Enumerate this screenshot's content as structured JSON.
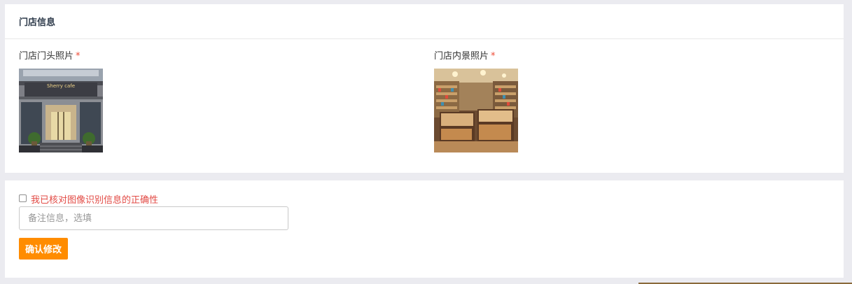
{
  "store_info": {
    "title": "门店信息",
    "front_photo": {
      "label": "门店门头照片",
      "required_mark": "*"
    },
    "interior_photo": {
      "label": "门店内景照片",
      "required_mark": "*"
    }
  },
  "confirm": {
    "checkbox_label": "我已核对图像识别信息的正确性",
    "checkbox_checked": false,
    "remark_placeholder": "备注信息，选填",
    "remark_value": "",
    "submit_label": "确认修改"
  },
  "colors": {
    "required_star": "#ee4b36",
    "confirm_text": "#e24a44",
    "submit_button": "#ff8c00",
    "page_background": "#ebebf0"
  }
}
